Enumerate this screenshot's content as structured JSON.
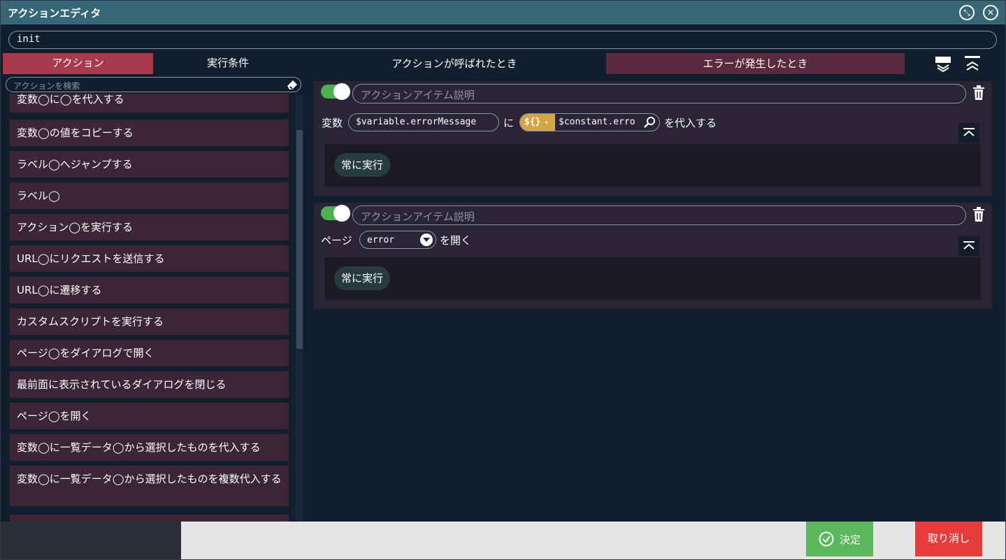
{
  "window": {
    "title": "アクションエディタ"
  },
  "name_field": {
    "value": "init"
  },
  "tabs": [
    {
      "label": "アクション"
    },
    {
      "label": "実行条件"
    },
    {
      "label": "アクションが呼ばれたとき"
    },
    {
      "label": "エラーが発生したとき"
    }
  ],
  "search": {
    "placeholder": "アクションを検索"
  },
  "action_list": [
    {
      "label": "変数◯に◯を代入する"
    },
    {
      "label": "変数◯の値をコピーする"
    },
    {
      "label": "ラベル◯へジャンプする"
    },
    {
      "label": "ラベル◯"
    },
    {
      "label": "アクション◯を実行する"
    },
    {
      "label": "URL◯にリクエストを送信する"
    },
    {
      "label": "URL◯に遷移する"
    },
    {
      "label": "カスタムスクリプトを実行する"
    },
    {
      "label": "ページ◯をダイアログで開く"
    },
    {
      "label": "最前面に表示されているダイアログを閉じる"
    },
    {
      "label": "ページ◯を開く"
    },
    {
      "label": "変数◯に一覧データ◯から選択したものを代入する"
    },
    {
      "label": "変数◯に一覧データ◯から選択したものを複数代入する"
    }
  ],
  "items": [
    {
      "enabled": true,
      "desc_placeholder": "アクションアイテム説明",
      "prefix": "変数",
      "variable": "$variable.errorMessage",
      "middle": "に",
      "expr_tag": "${}",
      "expr_value": "$constant.erro",
      "suffix": "を代入する",
      "condition": "常に実行"
    },
    {
      "enabled": true,
      "desc_placeholder": "アクションアイテム説明",
      "prefix": "ページ",
      "page": "error",
      "suffix": "を開く",
      "condition": "常に実行"
    }
  ],
  "footer": {
    "ok_label": "決定",
    "cancel_label": "取り消し"
  },
  "colors": {
    "accent_tab": "#a83a4d",
    "toggle_on": "#4caf50",
    "ok": "#5cb85c",
    "cancel": "#e63c3c"
  }
}
